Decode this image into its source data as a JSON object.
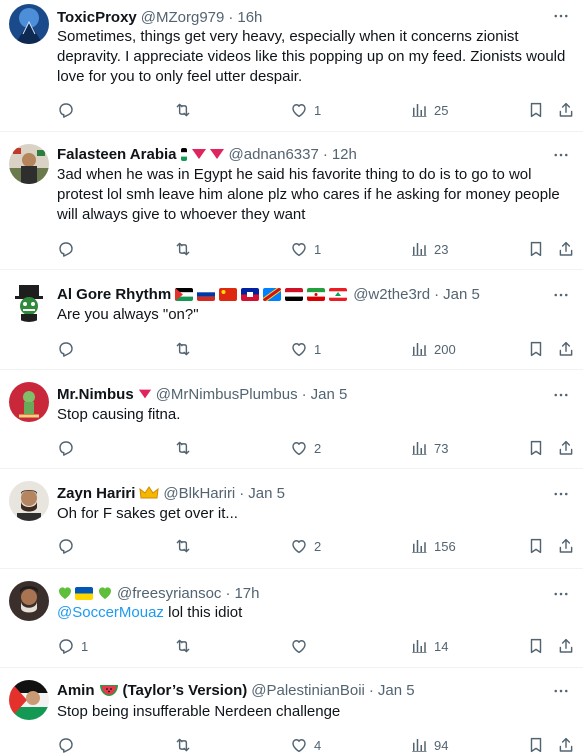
{
  "tweets": [
    {
      "name": "ToxicProxy",
      "handle": "@MZorg979",
      "sep": "·",
      "time": "16h",
      "text": "Sometimes, things get very heavy, especially when it concerns zionist depravity. I appreciate videos like this popping up on my feed. Zionists would love for you to only feel utter despair.",
      "replies": "",
      "retweets": "",
      "likes": "1",
      "views": "25"
    },
    {
      "name": "Falasteen Arabia",
      "name_suffix": "🇵🇸",
      "handle": "@adnan6337",
      "sep": "·",
      "time": "12h",
      "text": "3ad when he was in Egypt he said his favorite thing to do is to go to wol protest lol smh leave him alone plz who cares if he asking for money people will always give to whoever they want",
      "replies": "",
      "retweets": "",
      "likes": "1",
      "views": "23"
    },
    {
      "name": "Al Gore Rhythm",
      "handle": "@w2the3rd",
      "sep": "·",
      "time": "Jan 5",
      "text": "Are you always \"on?\"",
      "replies": "",
      "retweets": "",
      "likes": "1",
      "views": "200"
    },
    {
      "name": "Mr.Nimbus",
      "handle": "@MrNimbusPlumbus",
      "sep": "·",
      "time": "Jan 5",
      "text": "Stop causing fitna.",
      "replies": "",
      "retweets": "",
      "likes": "2",
      "views": "73"
    },
    {
      "name": "Zayn Hariri",
      "handle": "@BlkHariri",
      "sep": "·",
      "time": "Jan 5",
      "text": "Oh for F sakes get over it...",
      "replies": "",
      "retweets": "",
      "likes": "2",
      "views": "156"
    },
    {
      "name": "",
      "handle": "@freesyriansoc",
      "sep": "·",
      "time": "17h",
      "mention": "@SoccerMouaz",
      "text": " lol this idiot",
      "replies": "1",
      "retweets": "",
      "likes": "",
      "views": "14"
    },
    {
      "name": "Amin",
      "name_suffix": "(Taylor’s Version)",
      "handle": "@PalestinianBoii",
      "sep": "·",
      "time": "Jan 5",
      "text": "Stop being insufferable Nerdeen challenge",
      "replies": "",
      "retweets": "",
      "likes": "4",
      "views": "94"
    }
  ],
  "icons": {
    "reply": "reply-icon",
    "retweet": "retweet-icon",
    "like": "like-icon",
    "views": "views-icon",
    "bookmark": "bookmark-icon",
    "share": "share-icon",
    "more": "more-icon"
  },
  "colors": {
    "text": "#0f1419",
    "secondary": "#536471",
    "link": "#1d9bf0",
    "border": "#eff3f4"
  }
}
